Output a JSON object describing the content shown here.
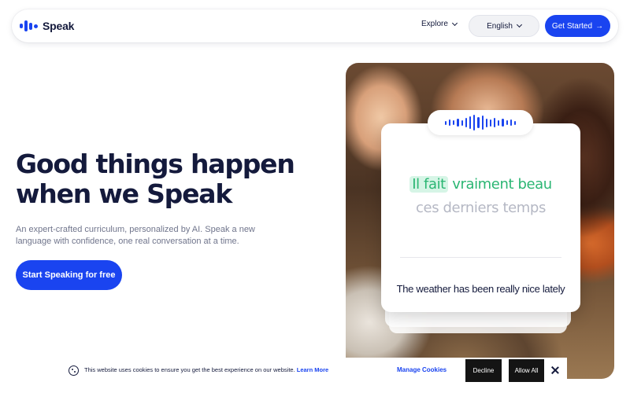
{
  "nav": {
    "logo_text": "Speak",
    "explore_label": "Explore",
    "language_label": "English",
    "get_started_label": "Get Started",
    "get_started_arrow": "→"
  },
  "hero": {
    "headline_line1": "Good things happen",
    "headline_line2": "when we Speak",
    "subtext": "An expert-crafted curriculum, personalized by AI. Speak a new language with confidence, one real conversation at a time.",
    "cta_label": "Start Speaking for free"
  },
  "lesson_card": {
    "phrase_known": "Il fait",
    "phrase_current": "vraiment beau",
    "phrase_upcoming": "ces derniers temps",
    "translation": "The weather has been really nice lately",
    "waveform_bars": [
      5,
      8,
      6,
      10,
      7,
      12,
      16,
      20,
      14,
      18,
      11,
      9,
      12,
      7,
      10,
      6,
      8,
      5
    ]
  },
  "cookie_bar": {
    "message": "This website uses cookies to ensure you get the best experience on our website.",
    "learn_more": "Learn More",
    "manage_label": "Manage Cookies",
    "decline_label": "Decline",
    "allow_label": "Allow All"
  },
  "colors": {
    "brand_blue": "#1a44f0",
    "navy_text": "#141a3c",
    "highlight_green": "#2bb673",
    "highlight_bg": "#d6f5e6",
    "muted_grey": "#b5b8c4"
  }
}
